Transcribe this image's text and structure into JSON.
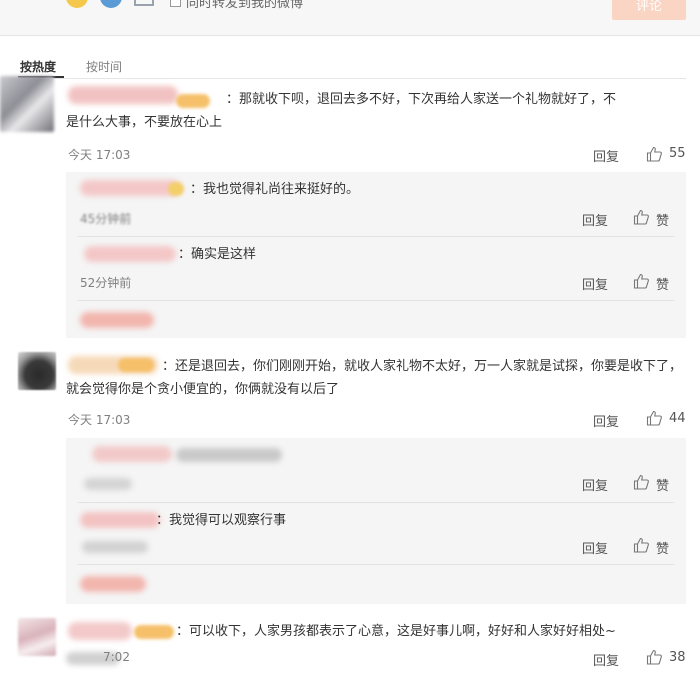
{
  "composer": {
    "checkbox_label": "同时转发到我的微博",
    "post_button": "评论"
  },
  "tabs": {
    "hot": "按热度",
    "time": "按时间"
  },
  "comments": [
    {
      "text": "：那就收下呗，退回去多不好，下次再给人家送一个礼物就好了，不是什么大事，不要放在心上",
      "time": "今天 17:03",
      "reply": "回复",
      "likes": "55",
      "replies": [
        {
          "text": "：我也觉得礼尚往来挺好的。",
          "time": "45分钟前",
          "reply": "回复",
          "like": "赞"
        },
        {
          "text": "：确实是这样",
          "time": "52分钟前",
          "reply": "回复",
          "like": "赞"
        }
      ]
    },
    {
      "text": "：还是退回去，你们刚刚开始，就收人家礼物不太好，万一人家就是试探，你要是收下了，就会觉得你是个贪小便宜的，你俩就没有以后了",
      "time": "今天 17:03",
      "reply": "回复",
      "likes": "44",
      "replies": [
        {
          "reply": "回复",
          "like": "赞"
        },
        {
          "text": "：我觉得可以观察行事",
          "reply": "回复",
          "like": "赞"
        }
      ]
    },
    {
      "text": "：可以收下，人家男孩都表示了心意，这是好事儿啊，好好和人家好好相处~",
      "time_suffix": "7:02",
      "reply": "回复",
      "likes": "38"
    }
  ],
  "colors": {
    "accent_orange": "#fa7d3c",
    "badge": "#f5c069",
    "text_muted": "#808080",
    "reply_bg": "#f5f5f5"
  },
  "icons": [
    "emoji-icon",
    "topic-icon",
    "picture-icon",
    "thumbs-up-icon"
  ]
}
